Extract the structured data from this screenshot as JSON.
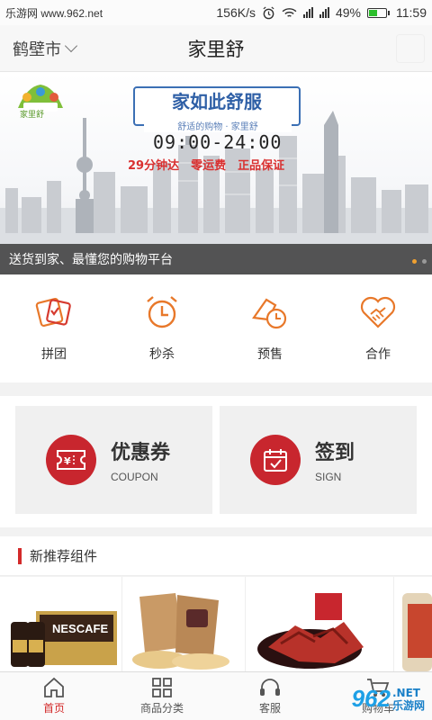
{
  "status_bar": {
    "carrier_text": "乐游网 www.962.net",
    "speed": "156K/s",
    "battery": "49%",
    "battery_level": 0.49,
    "time": "11:59"
  },
  "header": {
    "city": "鹤壁市",
    "title": "家里舒"
  },
  "banner": {
    "logo_text": "家里舒",
    "slogan": "家如此舒服",
    "slogan_sub": "舒适的购物 · 家里舒",
    "hours": "09:00-24:00",
    "promises": "29分钟达　零运费　正品保证",
    "caption": "送货到家、最懂您的购物平台",
    "slide_count": 2,
    "active_slide": 1
  },
  "quick_actions": [
    {
      "label": "拼团",
      "icon": "group-buy-icon"
    },
    {
      "label": "秒杀",
      "icon": "alarm-clock-icon"
    },
    {
      "label": "预售",
      "icon": "presale-clock-icon"
    },
    {
      "label": "合作",
      "icon": "handshake-icon"
    }
  ],
  "cards": [
    {
      "title": "优惠券",
      "subtitle": "COUPON",
      "icon": "coupon-icon"
    },
    {
      "title": "签到",
      "subtitle": "SIGN",
      "icon": "calendar-check-icon"
    }
  ],
  "section": {
    "title": "新推荐组件"
  },
  "products": [
    {
      "name": "nescafe-coffee"
    },
    {
      "name": "crackers"
    },
    {
      "name": "dried-meat"
    },
    {
      "name": "snack"
    }
  ],
  "tabs": [
    {
      "label": "首页",
      "icon": "home-icon",
      "active": true
    },
    {
      "label": "商品分类",
      "icon": "grid-icon",
      "active": false
    },
    {
      "label": "客服",
      "icon": "headset-icon",
      "active": false
    },
    {
      "label": "购物车",
      "icon": "cart-icon",
      "active": false
    }
  ],
  "watermark": {
    "big": "962",
    "line1": ".NET",
    "line2": "乐游网"
  },
  "colors": {
    "accent_red": "#c8262e",
    "orange": "#e8782a",
    "banner_blue": "#2e5fa6"
  }
}
